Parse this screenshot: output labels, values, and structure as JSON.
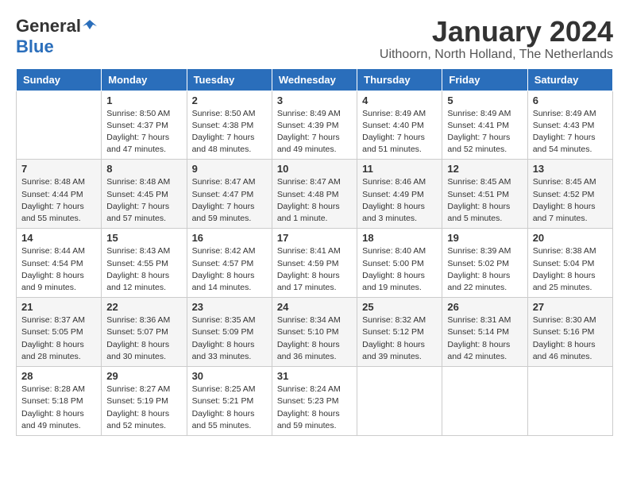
{
  "header": {
    "logo_general": "General",
    "logo_blue": "Blue",
    "month_title": "January 2024",
    "location": "Uithoorn, North Holland, The Netherlands"
  },
  "weekdays": [
    "Sunday",
    "Monday",
    "Tuesday",
    "Wednesday",
    "Thursday",
    "Friday",
    "Saturday"
  ],
  "weeks": [
    [
      {
        "day": "",
        "sunrise": "",
        "sunset": "",
        "daylight": ""
      },
      {
        "day": "1",
        "sunrise": "Sunrise: 8:50 AM",
        "sunset": "Sunset: 4:37 PM",
        "daylight": "Daylight: 7 hours and 47 minutes."
      },
      {
        "day": "2",
        "sunrise": "Sunrise: 8:50 AM",
        "sunset": "Sunset: 4:38 PM",
        "daylight": "Daylight: 7 hours and 48 minutes."
      },
      {
        "day": "3",
        "sunrise": "Sunrise: 8:49 AM",
        "sunset": "Sunset: 4:39 PM",
        "daylight": "Daylight: 7 hours and 49 minutes."
      },
      {
        "day": "4",
        "sunrise": "Sunrise: 8:49 AM",
        "sunset": "Sunset: 4:40 PM",
        "daylight": "Daylight: 7 hours and 51 minutes."
      },
      {
        "day": "5",
        "sunrise": "Sunrise: 8:49 AM",
        "sunset": "Sunset: 4:41 PM",
        "daylight": "Daylight: 7 hours and 52 minutes."
      },
      {
        "day": "6",
        "sunrise": "Sunrise: 8:49 AM",
        "sunset": "Sunset: 4:43 PM",
        "daylight": "Daylight: 7 hours and 54 minutes."
      }
    ],
    [
      {
        "day": "7",
        "sunrise": "Sunrise: 8:48 AM",
        "sunset": "Sunset: 4:44 PM",
        "daylight": "Daylight: 7 hours and 55 minutes."
      },
      {
        "day": "8",
        "sunrise": "Sunrise: 8:48 AM",
        "sunset": "Sunset: 4:45 PM",
        "daylight": "Daylight: 7 hours and 57 minutes."
      },
      {
        "day": "9",
        "sunrise": "Sunrise: 8:47 AM",
        "sunset": "Sunset: 4:47 PM",
        "daylight": "Daylight: 7 hours and 59 minutes."
      },
      {
        "day": "10",
        "sunrise": "Sunrise: 8:47 AM",
        "sunset": "Sunset: 4:48 PM",
        "daylight": "Daylight: 8 hours and 1 minute."
      },
      {
        "day": "11",
        "sunrise": "Sunrise: 8:46 AM",
        "sunset": "Sunset: 4:49 PM",
        "daylight": "Daylight: 8 hours and 3 minutes."
      },
      {
        "day": "12",
        "sunrise": "Sunrise: 8:45 AM",
        "sunset": "Sunset: 4:51 PM",
        "daylight": "Daylight: 8 hours and 5 minutes."
      },
      {
        "day": "13",
        "sunrise": "Sunrise: 8:45 AM",
        "sunset": "Sunset: 4:52 PM",
        "daylight": "Daylight: 8 hours and 7 minutes."
      }
    ],
    [
      {
        "day": "14",
        "sunrise": "Sunrise: 8:44 AM",
        "sunset": "Sunset: 4:54 PM",
        "daylight": "Daylight: 8 hours and 9 minutes."
      },
      {
        "day": "15",
        "sunrise": "Sunrise: 8:43 AM",
        "sunset": "Sunset: 4:55 PM",
        "daylight": "Daylight: 8 hours and 12 minutes."
      },
      {
        "day": "16",
        "sunrise": "Sunrise: 8:42 AM",
        "sunset": "Sunset: 4:57 PM",
        "daylight": "Daylight: 8 hours and 14 minutes."
      },
      {
        "day": "17",
        "sunrise": "Sunrise: 8:41 AM",
        "sunset": "Sunset: 4:59 PM",
        "daylight": "Daylight: 8 hours and 17 minutes."
      },
      {
        "day": "18",
        "sunrise": "Sunrise: 8:40 AM",
        "sunset": "Sunset: 5:00 PM",
        "daylight": "Daylight: 8 hours and 19 minutes."
      },
      {
        "day": "19",
        "sunrise": "Sunrise: 8:39 AM",
        "sunset": "Sunset: 5:02 PM",
        "daylight": "Daylight: 8 hours and 22 minutes."
      },
      {
        "day": "20",
        "sunrise": "Sunrise: 8:38 AM",
        "sunset": "Sunset: 5:04 PM",
        "daylight": "Daylight: 8 hours and 25 minutes."
      }
    ],
    [
      {
        "day": "21",
        "sunrise": "Sunrise: 8:37 AM",
        "sunset": "Sunset: 5:05 PM",
        "daylight": "Daylight: 8 hours and 28 minutes."
      },
      {
        "day": "22",
        "sunrise": "Sunrise: 8:36 AM",
        "sunset": "Sunset: 5:07 PM",
        "daylight": "Daylight: 8 hours and 30 minutes."
      },
      {
        "day": "23",
        "sunrise": "Sunrise: 8:35 AM",
        "sunset": "Sunset: 5:09 PM",
        "daylight": "Daylight: 8 hours and 33 minutes."
      },
      {
        "day": "24",
        "sunrise": "Sunrise: 8:34 AM",
        "sunset": "Sunset: 5:10 PM",
        "daylight": "Daylight: 8 hours and 36 minutes."
      },
      {
        "day": "25",
        "sunrise": "Sunrise: 8:32 AM",
        "sunset": "Sunset: 5:12 PM",
        "daylight": "Daylight: 8 hours and 39 minutes."
      },
      {
        "day": "26",
        "sunrise": "Sunrise: 8:31 AM",
        "sunset": "Sunset: 5:14 PM",
        "daylight": "Daylight: 8 hours and 42 minutes."
      },
      {
        "day": "27",
        "sunrise": "Sunrise: 8:30 AM",
        "sunset": "Sunset: 5:16 PM",
        "daylight": "Daylight: 8 hours and 46 minutes."
      }
    ],
    [
      {
        "day": "28",
        "sunrise": "Sunrise: 8:28 AM",
        "sunset": "Sunset: 5:18 PM",
        "daylight": "Daylight: 8 hours and 49 minutes."
      },
      {
        "day": "29",
        "sunrise": "Sunrise: 8:27 AM",
        "sunset": "Sunset: 5:19 PM",
        "daylight": "Daylight: 8 hours and 52 minutes."
      },
      {
        "day": "30",
        "sunrise": "Sunrise: 8:25 AM",
        "sunset": "Sunset: 5:21 PM",
        "daylight": "Daylight: 8 hours and 55 minutes."
      },
      {
        "day": "31",
        "sunrise": "Sunrise: 8:24 AM",
        "sunset": "Sunset: 5:23 PM",
        "daylight": "Daylight: 8 hours and 59 minutes."
      },
      {
        "day": "",
        "sunrise": "",
        "sunset": "",
        "daylight": ""
      },
      {
        "day": "",
        "sunrise": "",
        "sunset": "",
        "daylight": ""
      },
      {
        "day": "",
        "sunrise": "",
        "sunset": "",
        "daylight": ""
      }
    ]
  ]
}
